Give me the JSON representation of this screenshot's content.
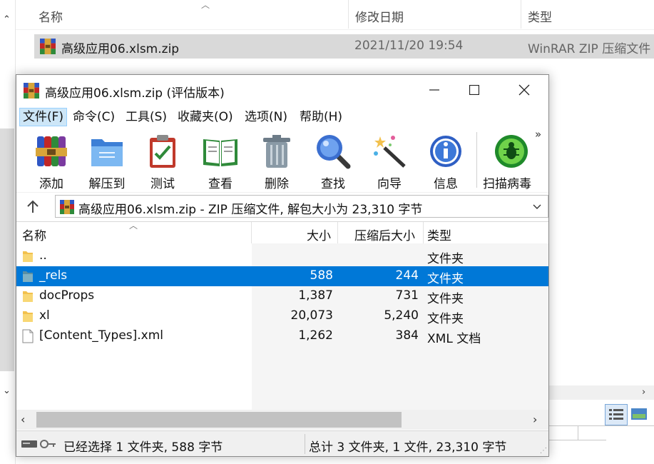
{
  "explorer": {
    "columns": {
      "name": "名称",
      "modified": "修改日期",
      "type": "类型"
    },
    "file": {
      "name": "高级应用06.xlsm.zip",
      "modified": "2021/11/20 19:54",
      "type": "WinRAR ZIP 压缩文件"
    }
  },
  "window": {
    "title": "高级应用06.xlsm.zip (评估版本)",
    "menu": [
      "文件(F)",
      "命令(C)",
      "工具(S)",
      "收藏夹(O)",
      "选项(N)",
      "帮助(H)"
    ],
    "toolbar": [
      "添加",
      "解压到",
      "测试",
      "查看",
      "删除",
      "查找",
      "向导",
      "信息",
      "扫描病毒"
    ],
    "address": "高级应用06.xlsm.zip - ZIP 压缩文件, 解包大小为 23,310 字节",
    "list": {
      "headers": {
        "name": "名称",
        "size": "大小",
        "packed": "压缩后大小",
        "type": "类型"
      },
      "rows": [
        {
          "name": "..",
          "size": "",
          "packed": "",
          "type": "文件夹",
          "icon": "folder-icon"
        },
        {
          "name": "_rels",
          "size": "588",
          "packed": "244",
          "type": "文件夹",
          "icon": "folder-icon",
          "selected": true
        },
        {
          "name": "docProps",
          "size": "1,387",
          "packed": "731",
          "type": "文件夹",
          "icon": "folder-icon"
        },
        {
          "name": "xl",
          "size": "20,073",
          "packed": "5,240",
          "type": "文件夹",
          "icon": "folder-icon"
        },
        {
          "name": "[Content_Types].xml",
          "size": "1,262",
          "packed": "384",
          "type": "XML 文档",
          "icon": "file-icon"
        }
      ]
    },
    "status": {
      "selection": "已经选择 1 文件夹, 588 字节",
      "total": "总计 3 文件夹, 1 文件, 23,310 字节"
    }
  },
  "colors": {
    "selection": "#0078d7",
    "menu_highlight": "#cde6f7"
  }
}
